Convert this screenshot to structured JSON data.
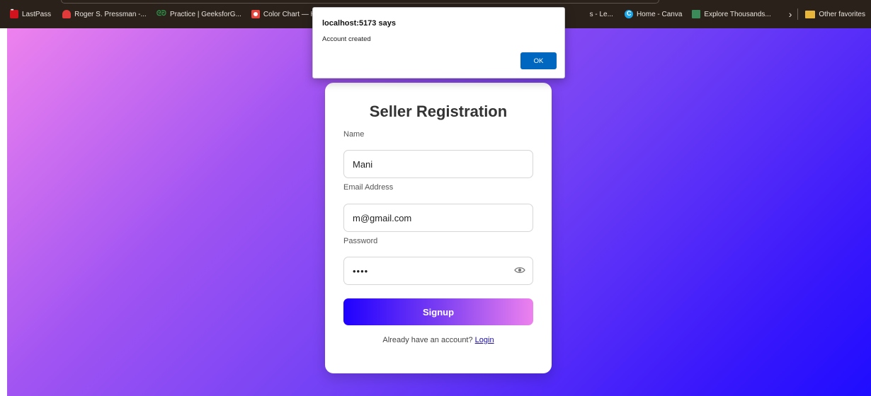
{
  "bookmarks_bar": {
    "items": [
      {
        "label": "LastPass",
        "icon": "lastpass-icon"
      },
      {
        "label": "Roger S. Pressman -...",
        "icon": "book-icon"
      },
      {
        "label": "Practice | GeeksforG...",
        "icon": "geeksforgeeks-icon"
      },
      {
        "label": "Color Chart — HTM...",
        "icon": "color-chart-icon"
      },
      {
        "label": "s - Le...",
        "icon": "page-icon"
      },
      {
        "label": "Home - Canva",
        "icon": "canva-icon"
      },
      {
        "label": "Explore Thousands...",
        "icon": "explore-icon"
      }
    ],
    "overflow_glyph": "›",
    "other_favorites": "Other favorites"
  },
  "form": {
    "title": "Seller Registration",
    "name_label": "Name",
    "name_value": "Mani",
    "email_label": "Email Address",
    "email_value": "m@gmail.com",
    "password_label": "Password",
    "password_mask": "••••",
    "signup_label": "Signup",
    "login_prompt": "Already have an account?",
    "login_link": "Login"
  },
  "alert": {
    "title": "localhost:5173 says",
    "message": "Account created",
    "ok_label": "OK"
  },
  "colors": {
    "gradient_start": "#ee82ee",
    "gradient_end": "#1f0cff",
    "ok_button": "#0067c0",
    "link": "#1a0dab"
  }
}
